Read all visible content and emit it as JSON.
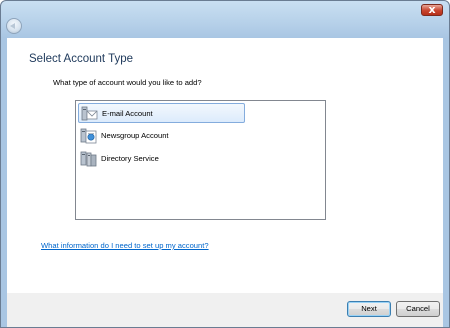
{
  "window": {
    "close_glyph": "x",
    "back_icon": "back-arrow-icon"
  },
  "main": {
    "heading": "Select Account Type",
    "question": "What type of account would you like to add?",
    "account_types": [
      {
        "label": "E-mail Account",
        "icon": "email-account-icon",
        "selected": true
      },
      {
        "label": "Newsgroup Account",
        "icon": "newsgroup-account-icon",
        "selected": false
      },
      {
        "label": "Directory Service",
        "icon": "directory-service-icon",
        "selected": false
      }
    ],
    "help_link": "What information do I need to set up my account?"
  },
  "footer": {
    "next_label": "Next",
    "cancel_label": "Cancel"
  },
  "colors": {
    "heading": "#1e395b",
    "link": "#0066cc",
    "selection_border": "#84acdd"
  }
}
